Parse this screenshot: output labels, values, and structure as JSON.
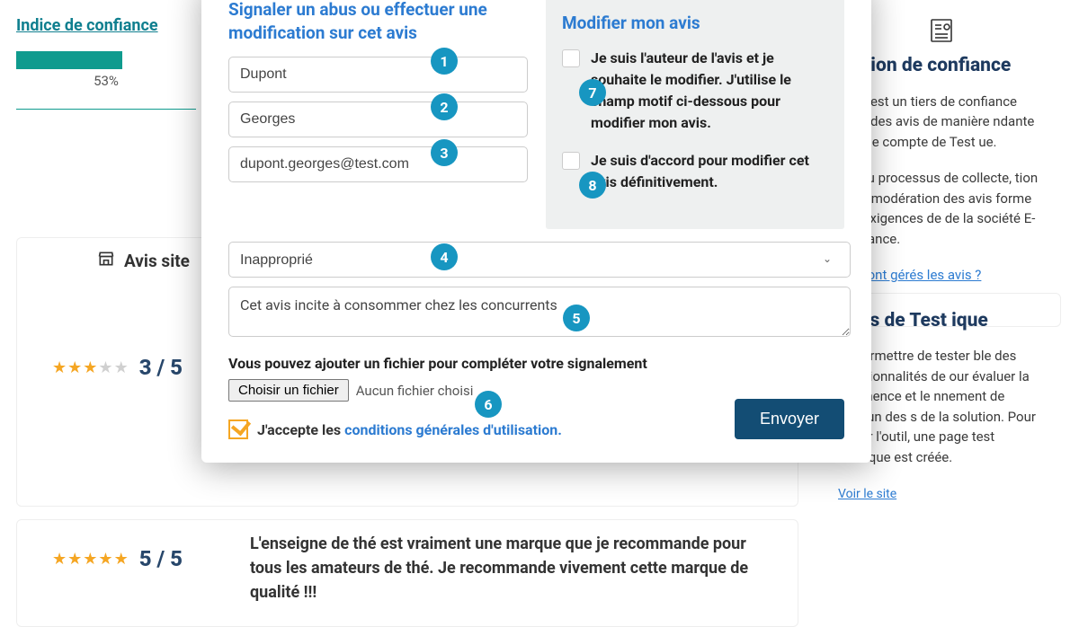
{
  "left": {
    "indice_link": "Indice de confiance",
    "progress_pct": "53%",
    "avis_site": "Avis site",
    "rating1_score": "3 / 5",
    "rating2_score": "5 / 5",
    "review2_body": "L'enseigne de thé est vraiment une marque que je recommande pour tous les amateurs de thé. Je recommande vivement cette marque de qualité !!!"
  },
  "right": {
    "h1": "station de confiance",
    "p1": "ance est un tiers de confiance lecte des avis de manière ndante pour le compte de Test ue.",
    "p2": "ion du processus de collecte, tion et de modération des avis forme aux exigences de de la société E-confiance.",
    "link1": "ent sont gérés les avis ?",
    "h2": "opos de Test ique",
    "p3": "va permettre de tester ble des fonctionnalités de our évaluer la pertinence et le nnement de chacun des s de la solution. Pour tester l'outil, une page test boutique est créée.",
    "link2": "Voir le site"
  },
  "modal": {
    "left_heading": "Signaler un abus ou effectuer une modification sur cet avis",
    "lastname": "Dupont",
    "firstname": "Georges",
    "email": "dupont.georges@test.com",
    "reason_selected": "Inapproprié",
    "comment": "Cet avis incite à consommer chez les concurrents",
    "file_label": "Vous pouvez ajouter un fichier pour compléter votre signalement",
    "file_btn": "Choisir un fichier",
    "file_status": "Aucun fichier choisi",
    "accept_prefix": "J'accepte les ",
    "accept_link": "conditions générales d'utilisation.",
    "send": "Envoyer",
    "right_heading": "Modifier mon avis",
    "cb1": "Je suis l'auteur de l'avis et je souhaite le modifier. J'utilise le champ motif ci-dessous pour modifier mon avis.",
    "cb2": "Je suis d'accord pour modifier cet avis définitivement."
  },
  "badges": [
    "1",
    "2",
    "3",
    "4",
    "5",
    "6",
    "7",
    "8"
  ]
}
